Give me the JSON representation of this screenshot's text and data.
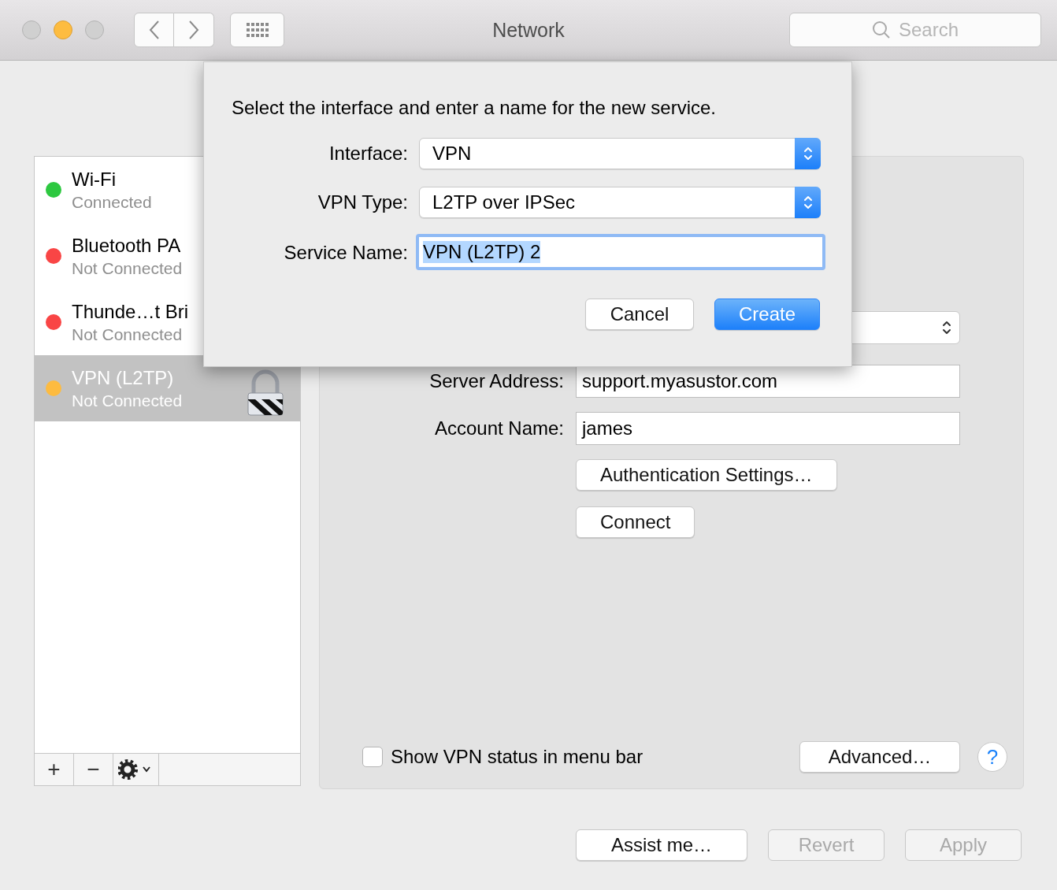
{
  "window": {
    "title": "Network"
  },
  "search": {
    "placeholder": "Search"
  },
  "services": [
    {
      "name": "Wi-Fi",
      "status": "Connected",
      "color": "#2dc840",
      "selected": false,
      "locked": false
    },
    {
      "name": "Bluetooth PA",
      "status": "Not Connected",
      "color": "#f94545",
      "selected": false,
      "locked": false
    },
    {
      "name": "Thunde…t Bri",
      "status": "Not Connected",
      "color": "#f94545",
      "selected": false,
      "locked": false
    },
    {
      "name": "VPN (L2TP)",
      "status": "Not Connected",
      "color": "#fdbb40",
      "selected": true,
      "locked": true
    }
  ],
  "sidebar_toolbar": [
    "+",
    "−"
  ],
  "pane": {
    "fields": [
      {
        "label": "Server Address:",
        "value": "support.myasustor.com"
      },
      {
        "label": "Account Name:",
        "value": "james"
      }
    ],
    "buttons": [
      "Authentication Settings…",
      "Connect"
    ],
    "show_status": {
      "label": "Show VPN status in menu bar",
      "checked": false
    },
    "advanced": "Advanced…",
    "help": "?"
  },
  "footer": [
    {
      "label": "Assist me…",
      "disabled": false
    },
    {
      "label": "Revert",
      "disabled": true
    },
    {
      "label": "Apply",
      "disabled": true
    }
  ],
  "sheet": {
    "prompt": "Select the interface and enter a name for the new service.",
    "popups": [
      {
        "label": "Interface:",
        "value": "VPN"
      },
      {
        "label": "VPN Type:",
        "value": "L2TP over IPSec"
      }
    ],
    "service_name": {
      "label": "Service Name:",
      "value": "VPN (L2TP) 2",
      "text_selected": true
    },
    "buttons": [
      {
        "label": "Cancel",
        "default": false
      },
      {
        "label": "Create",
        "default": true
      }
    ]
  }
}
